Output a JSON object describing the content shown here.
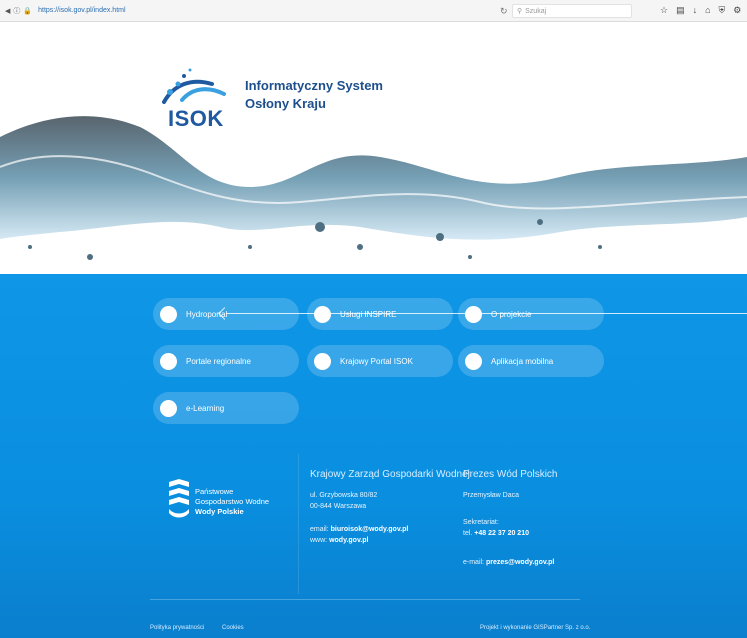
{
  "browser": {
    "url": "https://isok.gov.pl/index.html",
    "search_placeholder": "Szukaj"
  },
  "header": {
    "logo_text": "ISOK",
    "title_line1": "Informatyczny System",
    "title_line2": "Osłony Kraju"
  },
  "nav": {
    "items": [
      {
        "label": "Hydroportal"
      },
      {
        "label": "Usługi INSPIRE"
      },
      {
        "label": "O projekcie"
      },
      {
        "label": "Portale regionalne"
      },
      {
        "label": "Krajowy Portal ISOK"
      },
      {
        "label": "Aplikacja mobilna"
      },
      {
        "label": "e-Learning"
      }
    ]
  },
  "footer": {
    "pgw": {
      "line1": "Państwowe",
      "line2": "Gospodarstwo Wodne",
      "line3": "Wody Polskie"
    },
    "kzgw": {
      "heading": "Krajowy Zarząd Gospodarki Wodnej",
      "address1": "ul. Grzybowska 80/82",
      "address2": "00-844 Warszawa",
      "email_label": "email:",
      "email": "biuroisok@wody.gov.pl",
      "www_label": "www:",
      "www": "wody.gov.pl"
    },
    "prezes": {
      "heading": "Prezes Wód Polskich",
      "name": "Przemysław Daca",
      "sekretariat_label": "Sekretariat:",
      "tel_label": "tel.",
      "tel": "+48 22 37 20 210",
      "email_label": "e-mail:",
      "email": "prezes@wody.gov.pl"
    },
    "links": {
      "privacy": "Polityka prywatności",
      "cookies": "Cookies",
      "credits": "Projekt i wykonanie GISPartner Sp. z o.o."
    }
  },
  "colors": {
    "main_blue": "#0f96e6",
    "brand_blue": "#1d4f8c"
  }
}
